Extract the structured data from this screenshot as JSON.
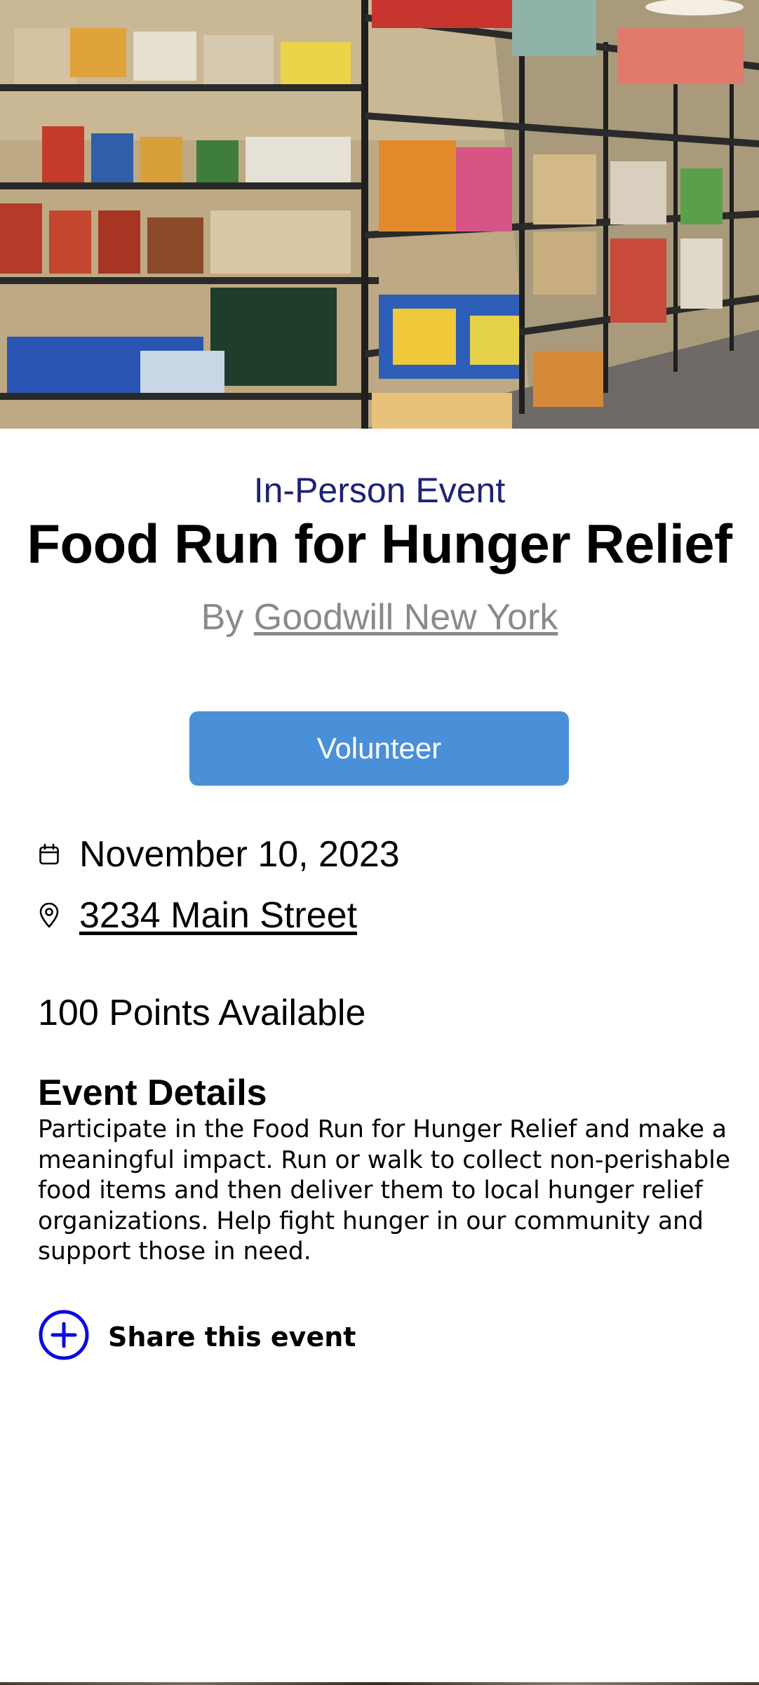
{
  "event": {
    "type": "In-Person Event",
    "title": "Food Run for Hunger Relief",
    "by_prefix": "By ",
    "organizer": "Goodwill New York",
    "volunteer_label": "Volunteer",
    "date": "November 10, 2023",
    "address": "3234 Main Street",
    "points": "100 Points Available",
    "details_heading": "Event Details",
    "details_body": "Participate in the Food Run for Hunger Relief and make a meaningful impact. Run or walk to collect non-perishable food items and then deliver them to local hunger relief organizations. Help fight hunger in our community and support those in need.",
    "share_label": "Share this event"
  },
  "icons": {
    "date": "calendar-icon",
    "location": "map-pin-icon",
    "share": "plus-circle-icon"
  },
  "colors": {
    "event_type": "#1c2275",
    "byline": "#8a8a8e",
    "volunteer_button": "#4a90d9",
    "share_icon": "#0a0ae0"
  }
}
